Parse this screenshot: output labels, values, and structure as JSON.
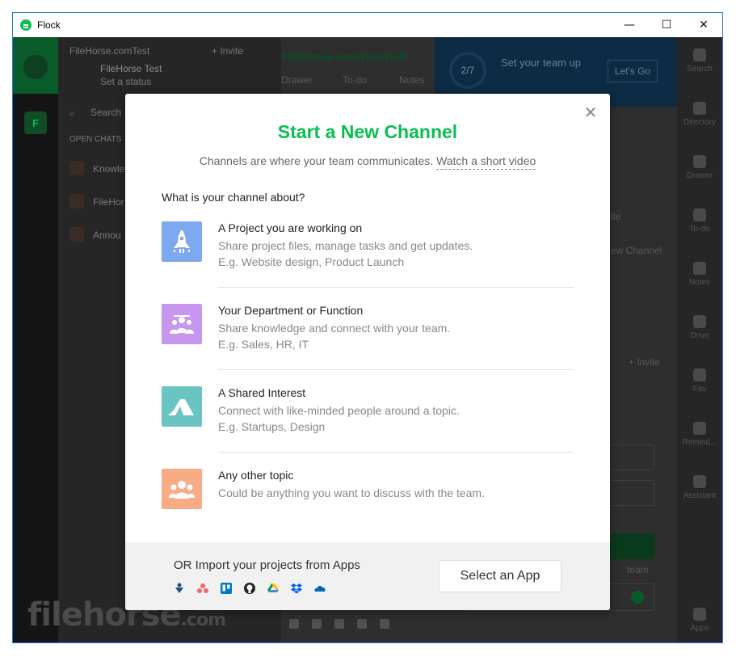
{
  "window": {
    "title": "Flock",
    "minimize_glyph": "—",
    "maximize_glyph": "☐",
    "close_glyph": "✕"
  },
  "background": {
    "team_initial": "F",
    "sidebar": {
      "team_name": "FileHorse.comTest",
      "invite": "+ Invite",
      "user_name": "FileHorse Test",
      "status": "Set a status",
      "search": "Search",
      "open_chats": "OPEN CHATS",
      "chats": [
        "Knowle",
        "FileHor",
        "Annou"
      ]
    },
    "main": {
      "hub_title": "FileHorse.comTest Hub",
      "tabs": [
        "Drawer",
        "To-do",
        "Notes"
      ],
      "banner_progress": "2/7",
      "banner_text": "Set your team up",
      "banner_button": "Let's Go",
      "fragments": [
        "ite",
        "ew Channel",
        "+ Invite",
        "team"
      ]
    },
    "rightbar": [
      "Search",
      "Directory",
      "Drawer",
      "To-do",
      "Notes",
      "Drive",
      "Fav",
      "Remind...",
      "Assistant",
      "Apps"
    ],
    "watermark": "filehorse",
    "watermark_suffix": ".com"
  },
  "modal": {
    "close_glyph": "✕",
    "title": "Start a New Channel",
    "subtitle": "Channels are where your team communicates.",
    "video_link": "Watch a short video",
    "question": "What is your channel about?",
    "options": [
      {
        "title": "A Project you are working on",
        "description": "Share project files, manage tasks and get updates.",
        "example": "E.g. Website design, Product Launch",
        "color": "#7ea8ef"
      },
      {
        "title": "Your Department or Function",
        "description": "Share knowledge and connect with your team.",
        "example": "E.g. Sales, HR, IT",
        "color": "#c796ef"
      },
      {
        "title": "A Shared Interest",
        "description": "Connect with like-minded people around a topic.",
        "example": "E.g. Startups, Design",
        "color": "#6ac4c1"
      },
      {
        "title": "Any other topic",
        "description": "Could be anything you want to discuss with the team.",
        "example": "",
        "color": "#f7ac86"
      }
    ],
    "footer": {
      "text": "OR Import your projects from Apps",
      "button": "Select an App",
      "apps": [
        "jira-icon",
        "asana-icon",
        "trello-icon",
        "github-icon",
        "google-drive-icon",
        "dropbox-icon",
        "onedrive-icon"
      ]
    }
  }
}
